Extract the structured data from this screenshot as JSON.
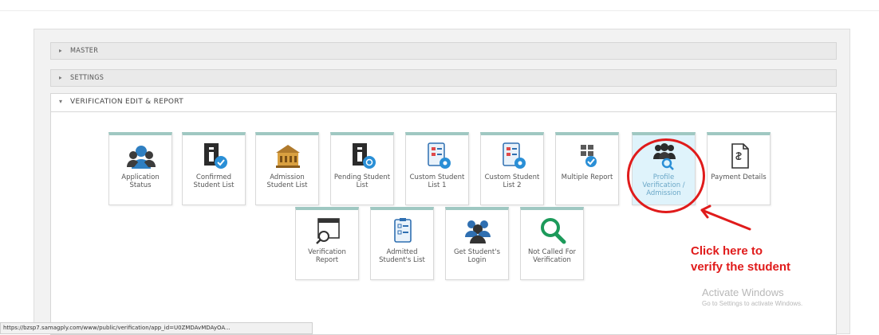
{
  "accordion": {
    "master_label": "Master",
    "settings_label": "Settings",
    "verification_label": "Verification Edit & Report"
  },
  "tiles": [
    {
      "label": "Application Status",
      "icon": "users-icon"
    },
    {
      "label": "Confirmed Student List",
      "icon": "confirmed-list-icon"
    },
    {
      "label": "Admission Student List",
      "icon": "building-icon"
    },
    {
      "label": "Pending Student List",
      "icon": "pending-list-icon"
    },
    {
      "label": "Custom Student List 1",
      "icon": "custom-list-icon"
    },
    {
      "label": "Custom Student List 2",
      "icon": "custom-list-icon"
    },
    {
      "label": "Multiple Report",
      "icon": "multiple-report-icon"
    },
    {
      "label": "Profile Verification / Admission",
      "icon": "profile-verify-icon"
    },
    {
      "label": "Payment Details",
      "icon": "payment-doc-icon"
    },
    {
      "label": "Verification Report",
      "icon": "verification-report-icon"
    },
    {
      "label": "Admitted Student's List",
      "icon": "clipboard-list-icon"
    },
    {
      "label": "Get Student's Login",
      "icon": "group-icon"
    },
    {
      "label": "Not Called For Verification",
      "icon": "magnifier-icon"
    }
  ],
  "annotation": {
    "line1": "Click here to",
    "line2": "verify the student",
    "color": "#e01b1b"
  },
  "watermark": {
    "line1": "Activate Windows",
    "line2": "Go to Settings to activate Windows."
  },
  "status_url": "https://bzsp7.samagply.com/www/public/verification/app_id=U0ZMDAvMDAyOA..."
}
